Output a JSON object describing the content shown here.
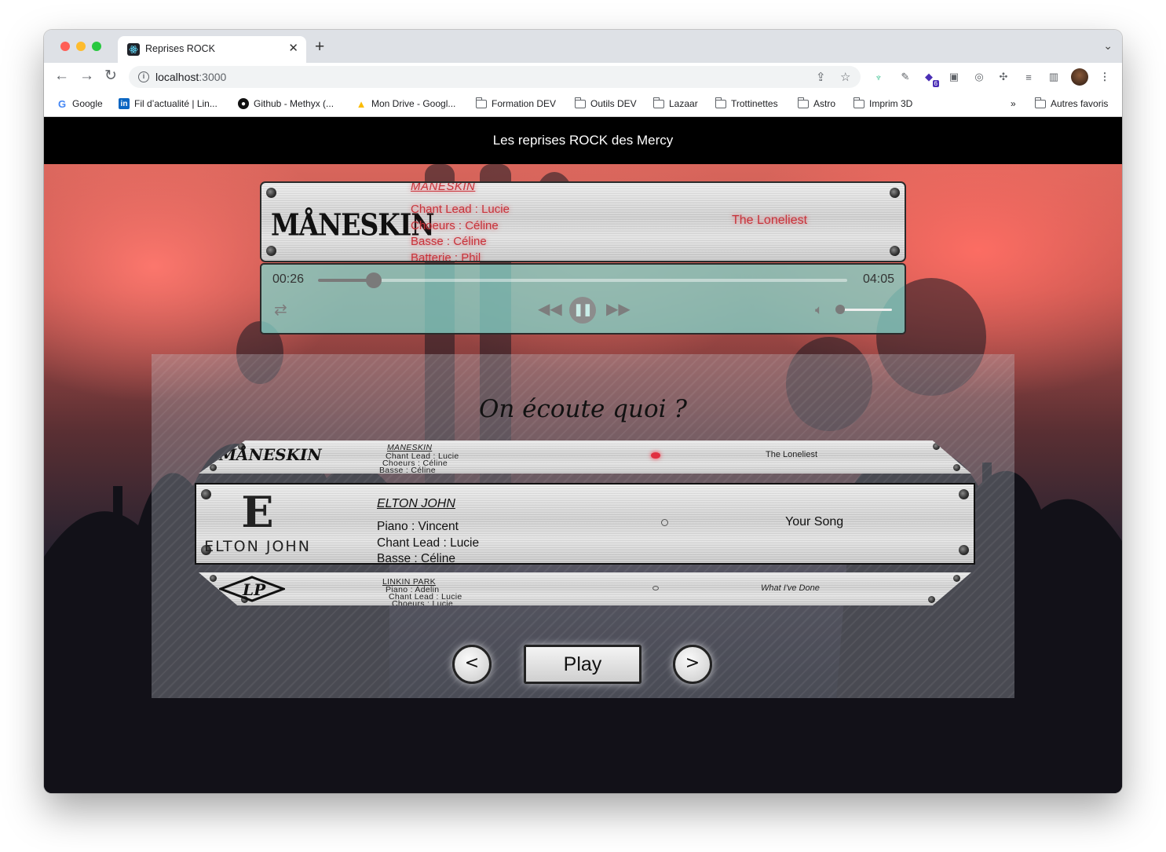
{
  "browser": {
    "tab_title": "Reprises ROCK",
    "url_host": "localhost",
    "url_port": ":3000",
    "bookmarks": [
      {
        "label": "Google",
        "icon": "google-icon"
      },
      {
        "label": "Fil d’actualité | Lin...",
        "icon": "linkedin-icon"
      },
      {
        "label": "Github - Methyx (...",
        "icon": "github-icon"
      },
      {
        "label": "Mon Drive - Googl...",
        "icon": "drive-icon"
      },
      {
        "label": "Formation DEV",
        "icon": "folder-icon"
      },
      {
        "label": "Outils DEV",
        "icon": "folder-icon"
      },
      {
        "label": "Lazaar",
        "icon": "folder-icon"
      },
      {
        "label": "Trottinettes",
        "icon": "folder-icon"
      },
      {
        "label": "Astro",
        "icon": "folder-icon"
      },
      {
        "label": "Imprim 3D",
        "icon": "folder-icon"
      }
    ],
    "more_bookmarks": "»",
    "other_bookmarks": "Autres favoris",
    "extension_badge": "6"
  },
  "header": {
    "title": "Les reprises ROCK des Mercy"
  },
  "now_playing": {
    "logo": "MÅNESKIN",
    "band": "MANESKIN",
    "lines": [
      "Chant Lead : Lucie",
      "Choeurs : Céline",
      "Basse : Céline",
      "Batterie : Phil"
    ],
    "song": "The Loneliest"
  },
  "player": {
    "elapsed": "00:26",
    "duration": "04:05",
    "progress": 0.106,
    "volume": 0.05
  },
  "selector": {
    "question": "On écoute quoi ?",
    "prev_card": {
      "logo": "MÅNESKIN",
      "band": "MANESKIN",
      "lines": [
        "Chant Lead : Lucie",
        "Choeurs : Céline",
        "Basse : Céline"
      ],
      "song": "The Loneliest"
    },
    "current_card": {
      "logo_letter": "E",
      "logo_name": "ELTON JOHN",
      "band": "ELTON JOHN",
      "lines": [
        "Piano : Vincent",
        "Chant Lead : Lucie",
        "Basse : Céline"
      ],
      "song": "Your Song"
    },
    "next_card": {
      "band": "LINKIN PARK",
      "lines": [
        "Piano : Adelin",
        "Chant Lead : Lucie",
        "Choeurs : Lucie"
      ],
      "song": "What I've Done"
    },
    "prev_label": "<",
    "play_label": "Play",
    "next_label": ">"
  }
}
